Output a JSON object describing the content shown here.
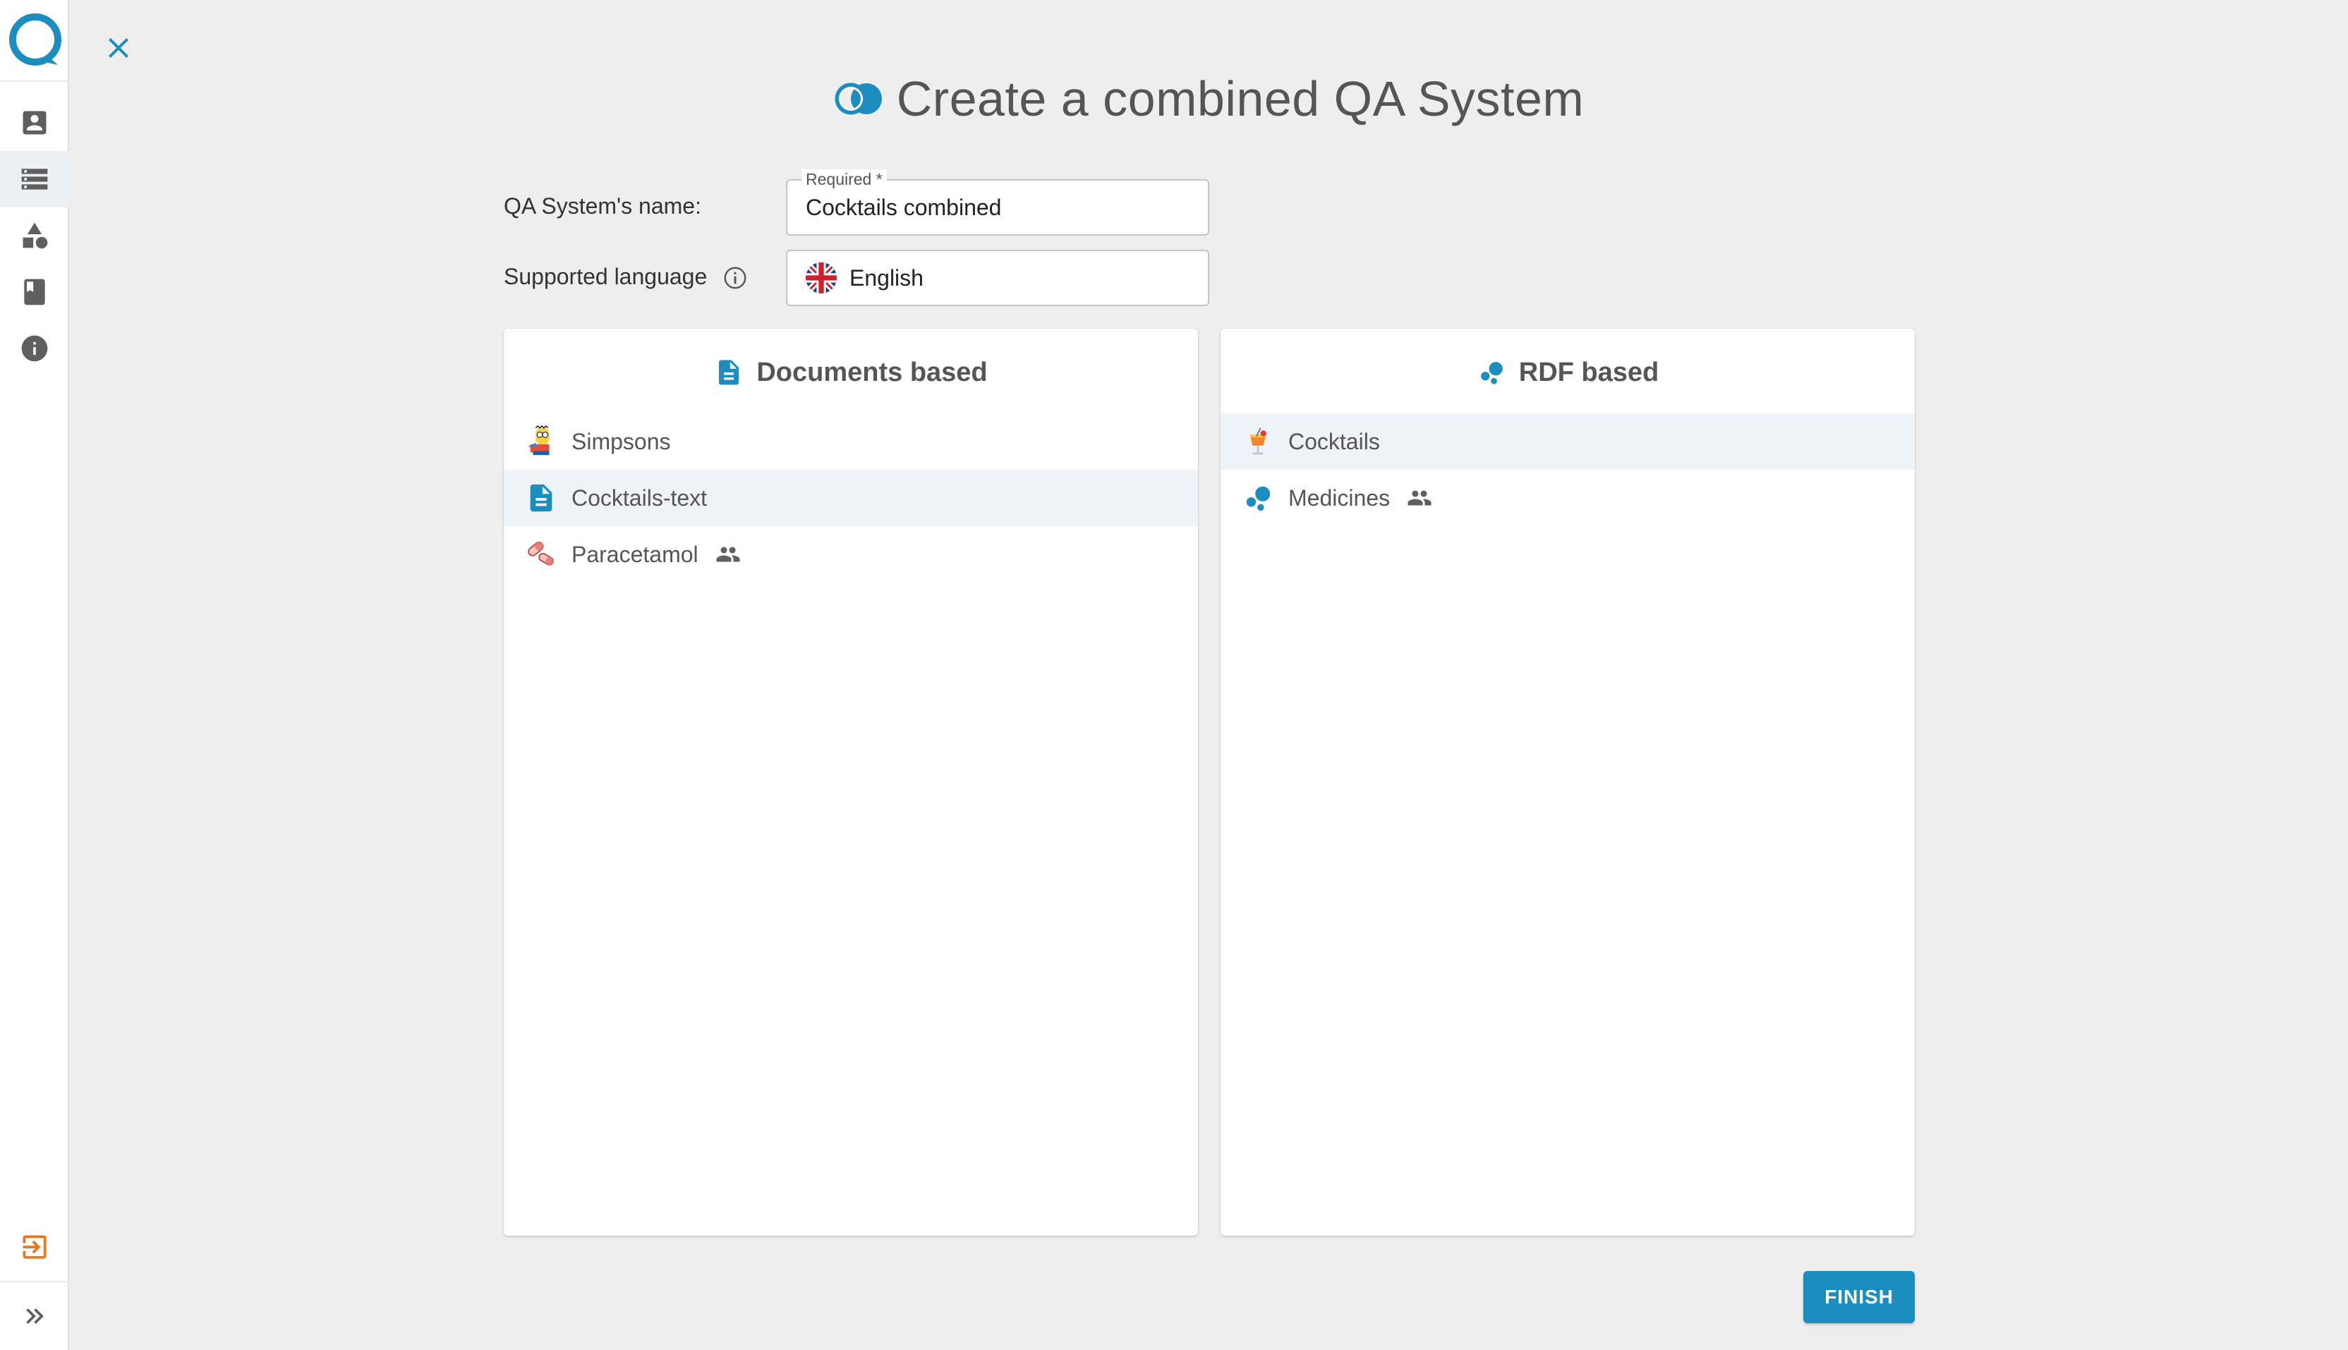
{
  "page": {
    "title": "Create a combined QA System",
    "colors": {
      "accent": "#1c8dbf",
      "logout": "#e8751a",
      "icon_gray": "#5f5f5f"
    }
  },
  "sidebar": {
    "items": [
      {
        "icon": "account-box-icon"
      },
      {
        "icon": "storage-icon",
        "active": true
      },
      {
        "icon": "shapes-icon"
      },
      {
        "icon": "book-icon"
      },
      {
        "icon": "info-icon"
      }
    ],
    "logout_icon": "logout-icon",
    "expand_icon": "double-chevron-right-icon"
  },
  "form": {
    "name_label": "QA System's name:",
    "name_legend": "Required *",
    "name_value": "Cocktails combined",
    "language_label": "Supported language",
    "language_value": "English"
  },
  "documents_panel": {
    "title": "Documents based",
    "items": [
      {
        "label": "Simpsons",
        "icon": "simpsons-icon",
        "shared": false,
        "selected": false
      },
      {
        "label": "Cocktails-text",
        "icon": "document-icon",
        "shared": false,
        "selected": true
      },
      {
        "label": "Paracetamol",
        "icon": "pills-icon",
        "shared": true,
        "selected": false
      }
    ]
  },
  "rdf_panel": {
    "title": "RDF based",
    "items": [
      {
        "label": "Cocktails",
        "icon": "cocktail-icon",
        "shared": false,
        "selected": true
      },
      {
        "label": "Medicines",
        "icon": "rdf-bubbles-icon",
        "shared": true,
        "selected": false
      }
    ]
  },
  "actions": {
    "finish_label": "FINISH"
  }
}
